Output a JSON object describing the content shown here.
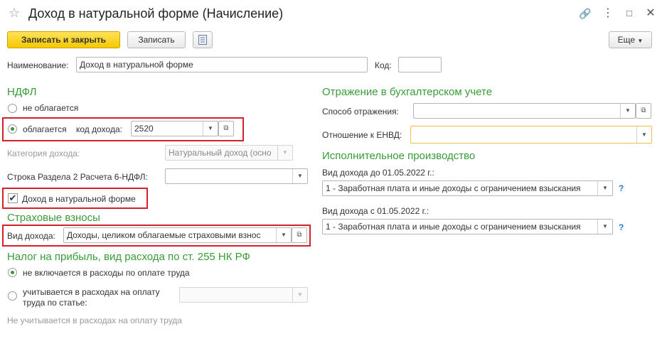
{
  "window": {
    "title": "Доход в натуральной форме (Начисление)"
  },
  "toolbar": {
    "save_close_label": "Записать и закрыть",
    "save_label": "Записать",
    "more_label": "Еще"
  },
  "form": {
    "name_label": "Наименование:",
    "name_value": "Доход в натуральной форме",
    "code_label": "Код:",
    "code_value": ""
  },
  "ndfl": {
    "section_title": "НДФЛ",
    "not_taxed_label": "не облагается",
    "taxed_label": "облагается",
    "income_code_label": "код дохода:",
    "income_code_value": "2520",
    "income_category_label": "Категория дохода:",
    "income_category_value": "Натуральный доход (осно",
    "section2_row_label": "Строка Раздела 2 Расчета 6-НДФЛ:",
    "section2_row_value": "",
    "natural_income_label": "Доход в натуральной форме",
    "natural_income_checked": true
  },
  "insurance": {
    "section_title": "Страховые взносы",
    "income_type_label": "Вид дохода:",
    "income_type_value": "Доходы, целиком облагаемые страховыми взнос"
  },
  "profit_tax": {
    "section_title": "Налог на прибыль, вид расхода по ст. 255 НК РФ",
    "not_included_label": "не включается в расходы по оплате труда",
    "included_label_line1": "учитывается в расходах на оплату",
    "included_label_line2": "труда по статье:",
    "included_value": "",
    "footer_note": "Не учитывается в расходах на оплату труда"
  },
  "accounting": {
    "section_title": "Отражение в бухгалтерском учете",
    "method_label": "Способ отражения:",
    "method_value": "",
    "envd_label": "Отношение к ЕНВД:",
    "envd_value": ""
  },
  "enforcement": {
    "section_title": "Исполнительное производство",
    "before_label": "Вид дохода до 01.05.2022 г.:",
    "before_value": "1 - Заработная плата и иные доходы с ограничением взыскания",
    "after_label": "Вид дохода с 01.05.2022 г.:",
    "after_value": "1 - Заработная плата и иные доходы с ограничением взыскания",
    "help_mark": "?"
  }
}
